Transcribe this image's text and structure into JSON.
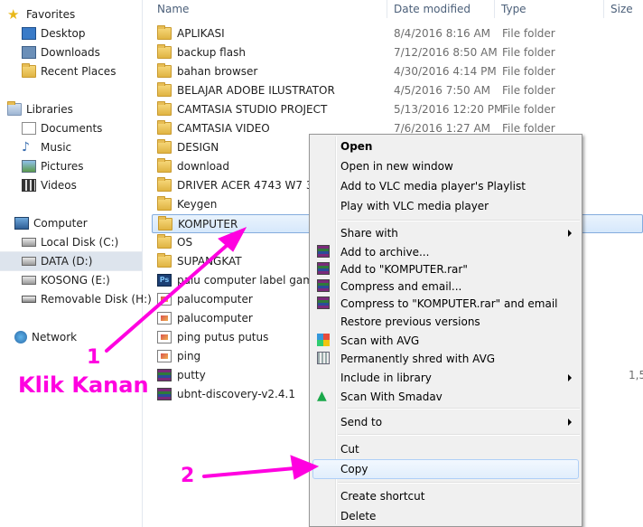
{
  "nav": {
    "favorites": "Favorites",
    "desktop": "Desktop",
    "downloads": "Downloads",
    "recent_places": "Recent Places",
    "libraries": "Libraries",
    "documents": "Documents",
    "music": "Music",
    "pictures": "Pictures",
    "videos": "Videos",
    "computer": "Computer",
    "local_disk": "Local Disk (C:)",
    "data": "DATA (D:)",
    "kosong": "KOSONG (E:)",
    "removable": "Removable Disk (H:)",
    "network": "Network"
  },
  "columns": {
    "name": "Name",
    "date_modified": "Date modified",
    "type": "Type",
    "size": "Size"
  },
  "files": [
    {
      "name": "APLIKASI",
      "date": "8/4/2016 8:16 AM",
      "type": "File folder",
      "size": ""
    },
    {
      "name": "backup flash",
      "date": "7/12/2016 8:50 AM",
      "type": "File folder",
      "size": ""
    },
    {
      "name": "bahan browser",
      "date": "4/30/2016 4:14 PM",
      "type": "File folder",
      "size": ""
    },
    {
      "name": "BELAJAR ADOBE ILUSTRATOR",
      "date": "4/5/2016 7:50 AM",
      "type": "File folder",
      "size": ""
    },
    {
      "name": "CAMTASIA STUDIO PROJECT",
      "date": "5/13/2016 12:20 PM",
      "type": "File folder",
      "size": ""
    },
    {
      "name": "CAMTASIA VIDEO",
      "date": "7/6/2016 1:27 AM",
      "type": "File folder",
      "size": ""
    },
    {
      "name": "DESIGN",
      "date": "",
      "type": "",
      "size": ""
    },
    {
      "name": "download",
      "date": "",
      "type": "",
      "size": ""
    },
    {
      "name": "DRIVER ACER 4743 W7 32 BI",
      "date": "",
      "type": "",
      "size": ""
    },
    {
      "name": "Keygen",
      "date": "",
      "type": "",
      "size": ""
    },
    {
      "name": "KOMPUTER",
      "date": "",
      "type": "",
      "size": ""
    },
    {
      "name": "OS",
      "date": "",
      "type": "",
      "size": ""
    },
    {
      "name": "SUPANGKAT",
      "date": "",
      "type": "",
      "size": ""
    },
    {
      "name": "palu computer label gamba",
      "date": "",
      "type": "p",
      "size": ""
    },
    {
      "name": "palucomputer",
      "date": "",
      "type": "",
      "size": ""
    },
    {
      "name": "palucomputer",
      "date": "",
      "type": "",
      "size": ""
    },
    {
      "name": "ping putus putus",
      "date": "",
      "type": "",
      "size": ""
    },
    {
      "name": "ping",
      "date": "",
      "type": "",
      "size": ""
    },
    {
      "name": "putty",
      "date": "",
      "type": "ive",
      "size": "1,5"
    },
    {
      "name": "ubnt-discovery-v2.4.1",
      "date": "",
      "type": "ive",
      "size": ""
    }
  ],
  "context_menu": {
    "open": "Open",
    "open_new_window": "Open in new window",
    "add_vlc_playlist": "Add to VLC media player's Playlist",
    "play_vlc": "Play with VLC media player",
    "share_with": "Share with",
    "add_archive": "Add to archive...",
    "add_rar": "Add to \"KOMPUTER.rar\"",
    "compress_email": "Compress and email...",
    "compress_rar_email": "Compress to \"KOMPUTER.rar\" and email",
    "restore_versions": "Restore previous versions",
    "scan_avg": "Scan with AVG",
    "shred_avg": "Permanently shred with AVG",
    "include_library": "Include in library",
    "scan_smadav": "Scan With Smadav",
    "send_to": "Send to",
    "cut": "Cut",
    "copy": "Copy",
    "create_shortcut": "Create shortcut",
    "delete": "Delete"
  },
  "annotations": {
    "step1_number": "1",
    "step1_text": "Klik Kanan",
    "step2_number": "2",
    "color": "#ff00e0"
  }
}
